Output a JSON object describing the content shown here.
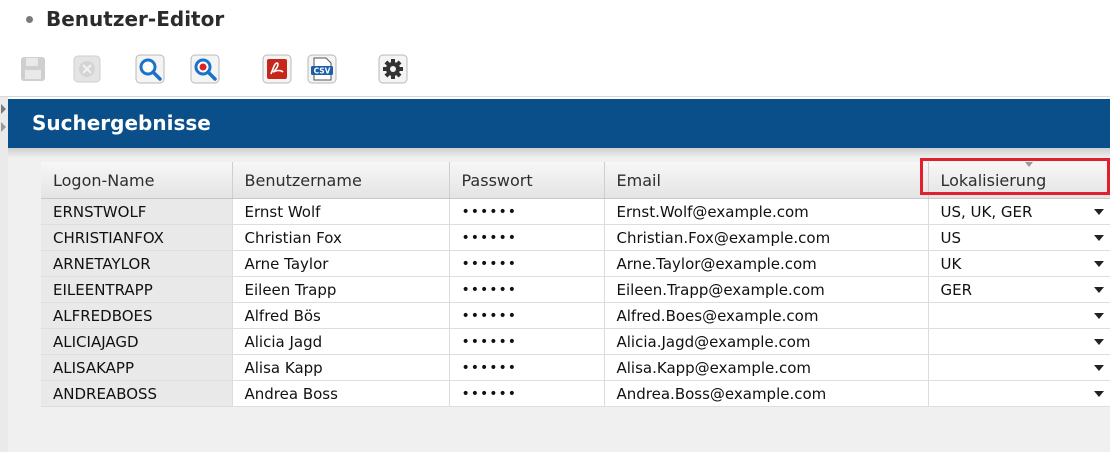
{
  "app": {
    "title": "Benutzer-Editor"
  },
  "toolbar": {
    "buttons": [
      {
        "icon": "save-icon",
        "enabled": false
      },
      {
        "icon": "cancel-icon",
        "enabled": false
      },
      {
        "icon": "search-icon",
        "enabled": true
      },
      {
        "icon": "search-reset-icon",
        "enabled": true
      },
      {
        "icon": "pdf-icon",
        "enabled": true
      },
      {
        "icon": "csv-icon",
        "enabled": true
      },
      {
        "icon": "settings-gear-icon",
        "enabled": true
      }
    ],
    "csv_label": "CSV"
  },
  "results": {
    "title": "Suchergebnisse",
    "columns": [
      "Logon-Name",
      "Benutzername",
      "Passwort",
      "Email",
      "Lokalisierung"
    ],
    "rows": [
      {
        "logon": "ERNSTWOLF",
        "name": "Ernst Wolf",
        "password": "••••••",
        "email": "Ernst.Wolf@example.com",
        "locale": "US, UK, GER"
      },
      {
        "logon": "CHRISTIANFOX",
        "name": "Christian Fox",
        "password": "••••••",
        "email": "Christian.Fox@example.com",
        "locale": "US"
      },
      {
        "logon": "ARNETAYLOR",
        "name": "Arne Taylor",
        "password": "••••••",
        "email": "Arne.Taylor@example.com",
        "locale": "UK"
      },
      {
        "logon": "EILEENTRAPP",
        "name": "Eileen Trapp",
        "password": "••••••",
        "email": "Eileen.Trapp@example.com",
        "locale": "GER"
      },
      {
        "logon": "ALFREDBOES",
        "name": "Alfred Bös",
        "password": "••••••",
        "email": "Alfred.Boes@example.com",
        "locale": ""
      },
      {
        "logon": "ALICIAJAGD",
        "name": "Alicia Jagd",
        "password": "••••••",
        "email": "Alicia.Jagd@example.com",
        "locale": ""
      },
      {
        "logon": "ALISAKAPP",
        "name": "Alisa Kapp",
        "password": "••••••",
        "email": "Alisa.Kapp@example.com",
        "locale": ""
      },
      {
        "logon": "ANDREABOSS",
        "name": "Andrea Boss",
        "password": "••••••",
        "email": "Andrea.Boss@example.com",
        "locale": ""
      }
    ]
  },
  "colors": {
    "header_band": "#0a4f8a",
    "highlight": "#e0202e"
  }
}
